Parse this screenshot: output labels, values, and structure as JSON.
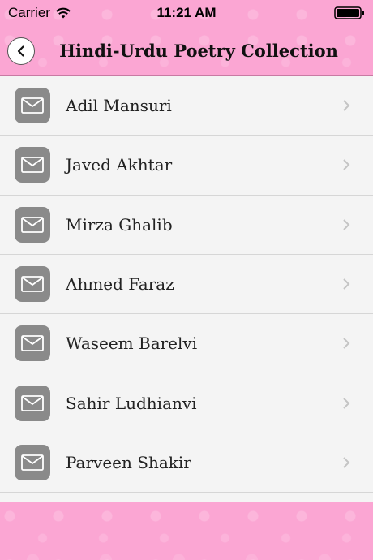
{
  "status_bar": {
    "carrier": "Carrier",
    "time": "11:21 AM"
  },
  "nav": {
    "title": "Hindi-Urdu Poetry Collection",
    "back_icon": "chevron-left-icon"
  },
  "list": {
    "items": [
      {
        "label": "Adil Mansuri",
        "icon": "envelope-icon"
      },
      {
        "label": "Javed Akhtar",
        "icon": "envelope-icon"
      },
      {
        "label": "Mirza Ghalib",
        "icon": "envelope-icon"
      },
      {
        "label": "Ahmed Faraz",
        "icon": "envelope-icon"
      },
      {
        "label": "Waseem Barelvi",
        "icon": "envelope-icon"
      },
      {
        "label": "Sahir Ludhianvi",
        "icon": "envelope-icon"
      },
      {
        "label": "Parveen Shakir",
        "icon": "envelope-icon"
      }
    ]
  },
  "colors": {
    "theme_pink": "#fba6d3",
    "icon_gray": "#8a8a8a",
    "list_bg": "#f4f4f4"
  }
}
